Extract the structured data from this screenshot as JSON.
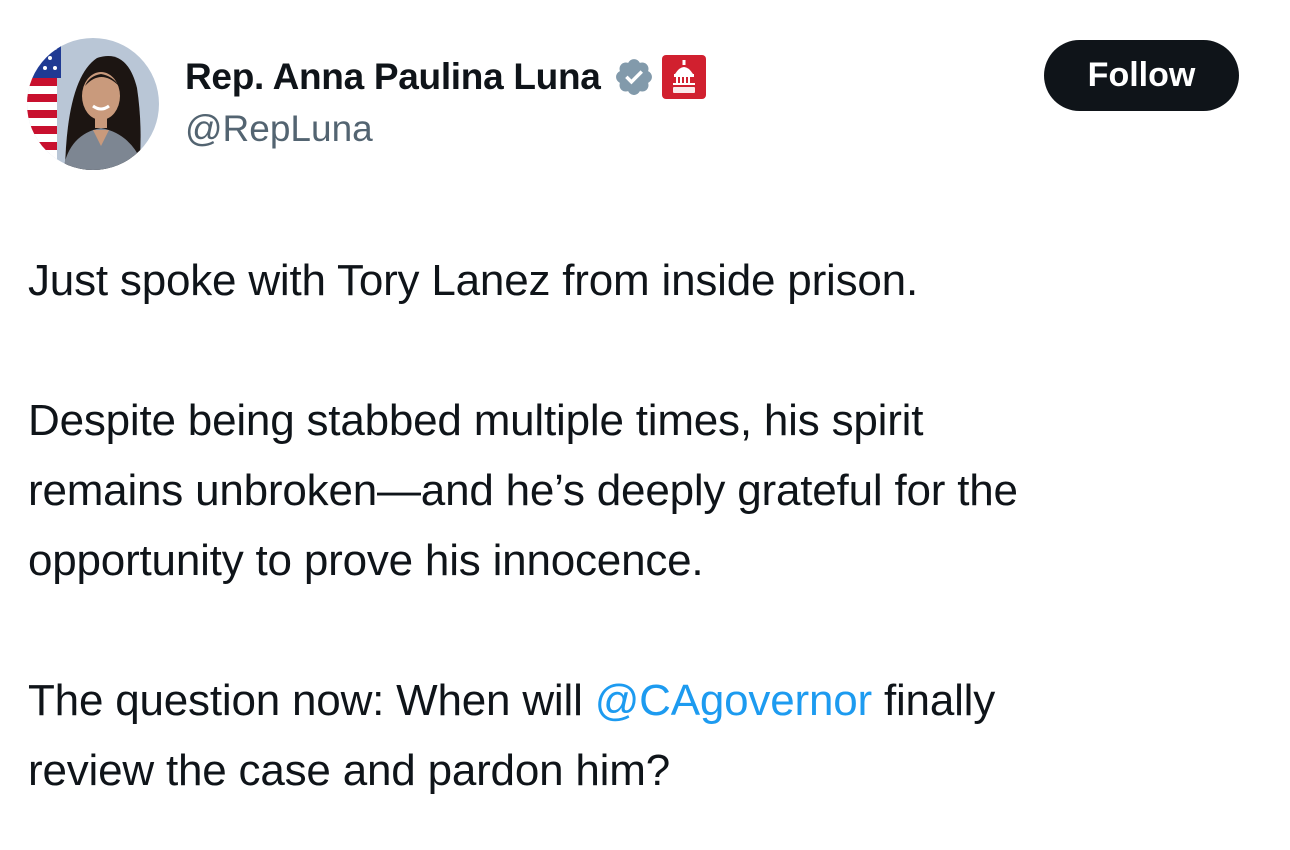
{
  "author": {
    "display_name": "Rep. Anna Paulina Luna",
    "handle": "@RepLuna",
    "avatar_icon": "profile-photo",
    "verified_icon": "verified-badge-icon",
    "affiliate_icon": "house-gop-capitol-icon"
  },
  "actions": {
    "follow_label": "Follow"
  },
  "tweet": {
    "para1": "Just spoke with Tory Lanez from inside prison.",
    "para2_line1": "Despite being stabbed multiple times, his spirit",
    "para2_line2": "remains unbroken—and he’s deeply grateful for the",
    "para2_line3": "opportunity to prove his innocence.",
    "para3_before": "The question now: When will ",
    "para3_mention": "@CAgovernor",
    "para3_after": " finally",
    "para3_line2": "review the case and pardon him?"
  },
  "colors": {
    "text": "#0f1419",
    "secondary": "#536471",
    "link": "#1d9bf0",
    "verified": "#829aab",
    "affiliate": "#d1202f"
  }
}
